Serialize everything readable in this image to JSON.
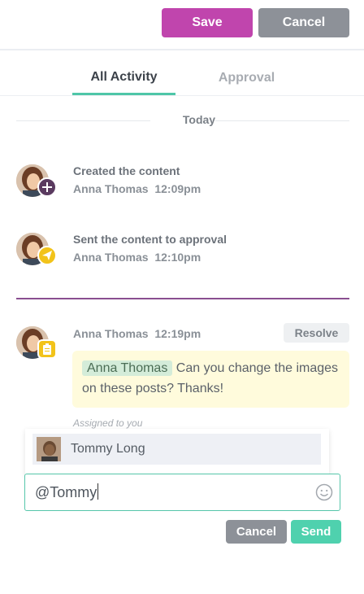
{
  "toolbar": {
    "save_label": "Save",
    "cancel_label": "Cancel"
  },
  "tabs": [
    {
      "label": "All Activity",
      "active": true
    },
    {
      "label": "Approval",
      "active": false
    }
  ],
  "day_label": "Today",
  "activities": [
    {
      "text": "Created the content",
      "author": "Anna Thomas",
      "time": "12:09pm",
      "badge_icon": "plus-icon",
      "badge_color": "#5a3a5f"
    },
    {
      "text": "Sent the content to approval",
      "author": "Anna Thomas",
      "time": "12:10pm",
      "badge_icon": "paper-plane-icon",
      "badge_color": "#f2c31a"
    }
  ],
  "comment": {
    "author": "Anna Thomas",
    "time": "12:19pm",
    "badge_icon": "clipboard-icon",
    "badge_color": "#f2c31a",
    "resolve_label": "Resolve",
    "mention": "Anna Thomas",
    "text": "Can you change the images on these posts? Thanks!",
    "assigned": "Assigned to you"
  },
  "mention_suggestions": [
    {
      "name": "Tommy Long"
    }
  ],
  "reply_input": {
    "value": "@Tommy"
  },
  "reply_actions": {
    "cancel_label": "Cancel",
    "send_label": "Send"
  },
  "colors": {
    "accent_green": "#4fd1ae",
    "brand_purple": "#c045ad",
    "divider_purple": "#8a4f90",
    "neutral_button": "#8d9198"
  }
}
